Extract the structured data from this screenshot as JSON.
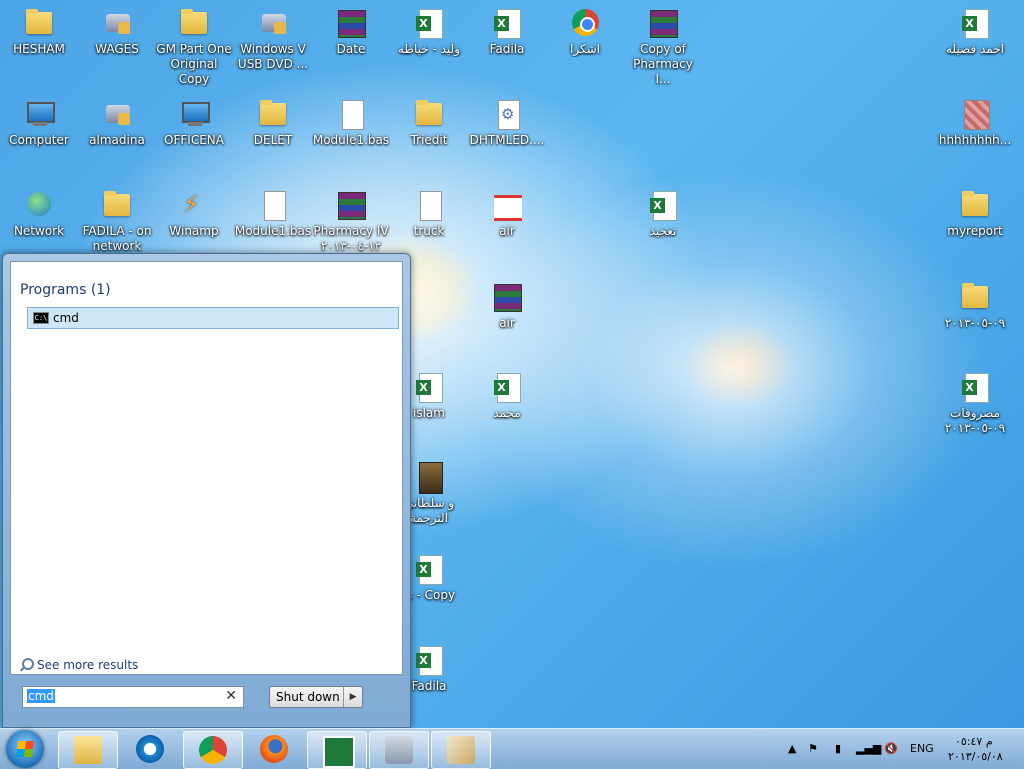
{
  "desktop_icons": [
    {
      "label": "HESHAM",
      "type": "folder"
    },
    {
      "label": "WAGES",
      "type": "program"
    },
    {
      "label": "GM Part One Original Copy",
      "type": "folder"
    },
    {
      "label": "Windows V USB DVD ...",
      "type": "program"
    },
    {
      "label": "Date",
      "type": "rar"
    },
    {
      "label": "وليد - خياطه",
      "type": "excel"
    },
    {
      "label": "Fadila",
      "type": "excel"
    },
    {
      "label": "اشكرا",
      "type": "chrome"
    },
    {
      "label": "Copy of Pharmacy I...",
      "type": "rar"
    },
    {
      "label": "احمد فضيله",
      "type": "excel"
    },
    {
      "label": "Computer",
      "type": "computer"
    },
    {
      "label": "almadina",
      "type": "program"
    },
    {
      "label": "OFFICENA",
      "type": "program"
    },
    {
      "label": "DELET",
      "type": "folder"
    },
    {
      "label": "Module1.bas",
      "type": "file"
    },
    {
      "label": "Triedit",
      "type": "folder"
    },
    {
      "label": "DHTMLED....",
      "type": "gear"
    },
    {
      "label": "hhhhhhhh...",
      "type": "picture"
    },
    {
      "label": "Network",
      "type": "network"
    },
    {
      "label": "FADILA - on network",
      "type": "folder"
    },
    {
      "label": "Winamp",
      "type": "winamp"
    },
    {
      "label": "Module1.bas",
      "type": "file"
    },
    {
      "label": "Pharmacy IV ١٢-٠٤-٢٠١٣",
      "type": "rar"
    },
    {
      "label": "truck",
      "type": "file"
    },
    {
      "label": "air",
      "type": "air"
    },
    {
      "label": "تعجيد",
      "type": "excel"
    },
    {
      "label": "myreport",
      "type": "folder"
    },
    {
      "label": "air",
      "type": "rar"
    },
    {
      "label": "٠٩-٠٥-٢٠١٣",
      "type": "folder"
    },
    {
      "label": "islam",
      "type": "excel"
    },
    {
      "label": "محمد",
      "type": "excel"
    },
    {
      "label": "مصروفات ٠٩-٠٥-٢٠١٣",
      "type": "excel"
    },
    {
      "label": "و سلطاني الترجمة",
      "type": "video"
    },
    {
      "label": "تع - Copy",
      "type": "excel"
    },
    {
      "label": "Fadila",
      "type": "excel"
    }
  ],
  "start_menu": {
    "programs_heading": "Programs (1)",
    "program_item": "cmd",
    "see_more": "See more results",
    "search_value": "cmd",
    "clear_symbol": "✕",
    "shutdown_label": "Shut down",
    "shutdown_arrow": "▶"
  },
  "taskbar": {
    "pinned": [
      "Windows Explorer",
      "Internet Explorer",
      "Google Chrome",
      "Firefox",
      "Excel",
      "Program",
      "Editor"
    ],
    "tray": {
      "language": "ENG",
      "time": "م ٠٥:٤٧",
      "date": "٢٠١٣/٠٥/٠٨"
    }
  }
}
